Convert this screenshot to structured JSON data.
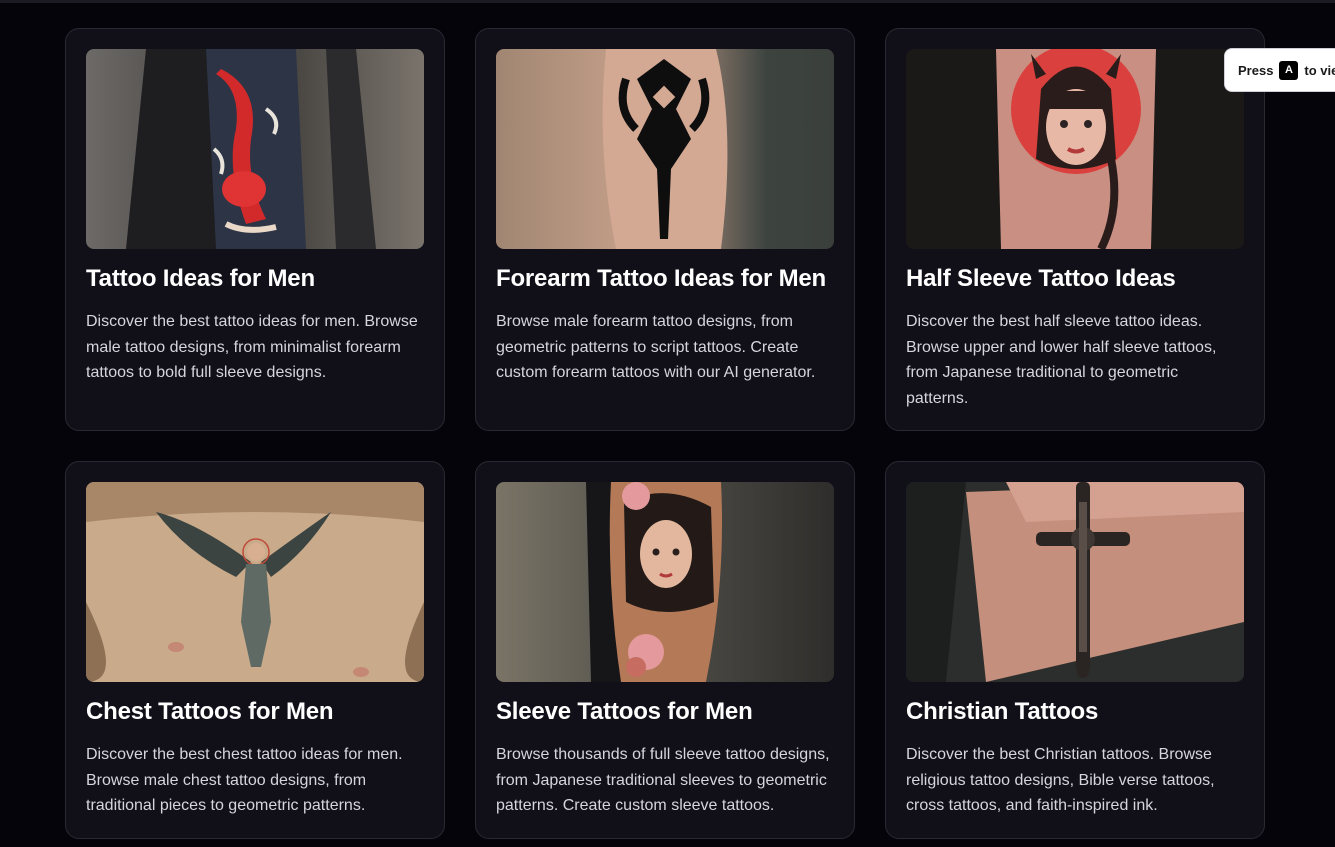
{
  "cards": [
    {
      "title": "Tattoo Ideas for Men",
      "description": "Discover the best tattoo ideas for men. Browse male tattoo designs, from minimalist forearm tattoos to bold full sleeve designs.",
      "image_icon": "koi-sleeve-image"
    },
    {
      "title": "Forearm Tattoo Ideas for Men",
      "description": "Browse male forearm tattoo designs, from geometric patterns to script tattoos. Create custom forearm tattoos with our AI generator.",
      "image_icon": "tribal-arm-image"
    },
    {
      "title": "Half Sleeve Tattoo Ideas",
      "description": "Discover the best half sleeve tattoo ideas. Browse upper and lower half sleeve tattoos, from Japanese traditional to geometric patterns.",
      "image_icon": "portrait-tattoo-image"
    },
    {
      "title": "Chest Tattoos for Men",
      "description": "Discover the best chest tattoo ideas for men. Browse male chest tattoo designs, from traditional pieces to geometric patterns.",
      "image_icon": "angel-chest-image"
    },
    {
      "title": "Sleeve Tattoos for Men",
      "description": "Browse thousands of full sleeve tattoo designs, from Japanese traditional sleeves to geometric patterns. Create custom sleeve tattoos.",
      "image_icon": "geisha-sleeve-image"
    },
    {
      "title": "Christian Tattoos",
      "description": "Discover the best Christian tattoos. Browse religious tattoo designs, Bible verse tattoos, cross tattoos, and faith-inspired ink.",
      "image_icon": "cross-forearm-image"
    }
  ],
  "toast": {
    "prefix": "Press",
    "key": "A",
    "suffix": "to vie"
  },
  "colors": {
    "page_bg": "#05040a",
    "card_bg": "#110f17",
    "card_border": "#2a2832",
    "title": "#ffffff",
    "body_text": "#d6d4dc"
  }
}
